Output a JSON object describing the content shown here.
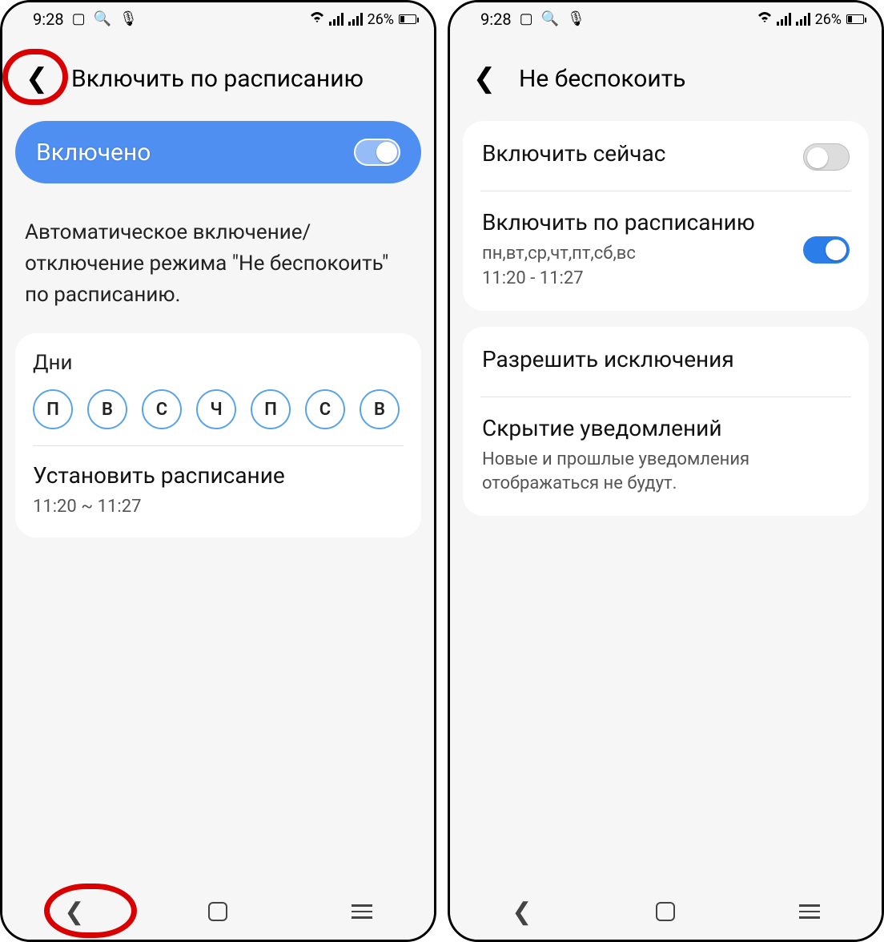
{
  "status": {
    "time": "9:28",
    "battery_pct": "26%",
    "icons": [
      "image-icon",
      "search-icon",
      "mic-icon",
      "wifi-icon",
      "signal-icon",
      "signal-icon",
      "battery-icon"
    ]
  },
  "left": {
    "title": "Включить по расписанию",
    "enabled_label": "Включено",
    "description": "Автоматическое включение/отключение режима \"Не беспокоить\" по расписанию.",
    "days_label": "Дни",
    "days": [
      "П",
      "В",
      "С",
      "Ч",
      "П",
      "С",
      "В"
    ],
    "schedule_label": "Установить расписание",
    "schedule_value": "11:20 ~ 11:27"
  },
  "right": {
    "title": "Не беспокоить",
    "enable_now": "Включить сейчас",
    "enable_schedule": "Включить по расписанию",
    "enable_schedule_days": "пн,вт,ср,чт,пт,сб,вс",
    "enable_schedule_time": "11:20 - 11:27",
    "allow_exceptions": "Разрешить исключения",
    "hide_notifications": "Скрытие уведомлений",
    "hide_notifications_sub": "Новые и прошлые уведомления отображаться не будут."
  }
}
